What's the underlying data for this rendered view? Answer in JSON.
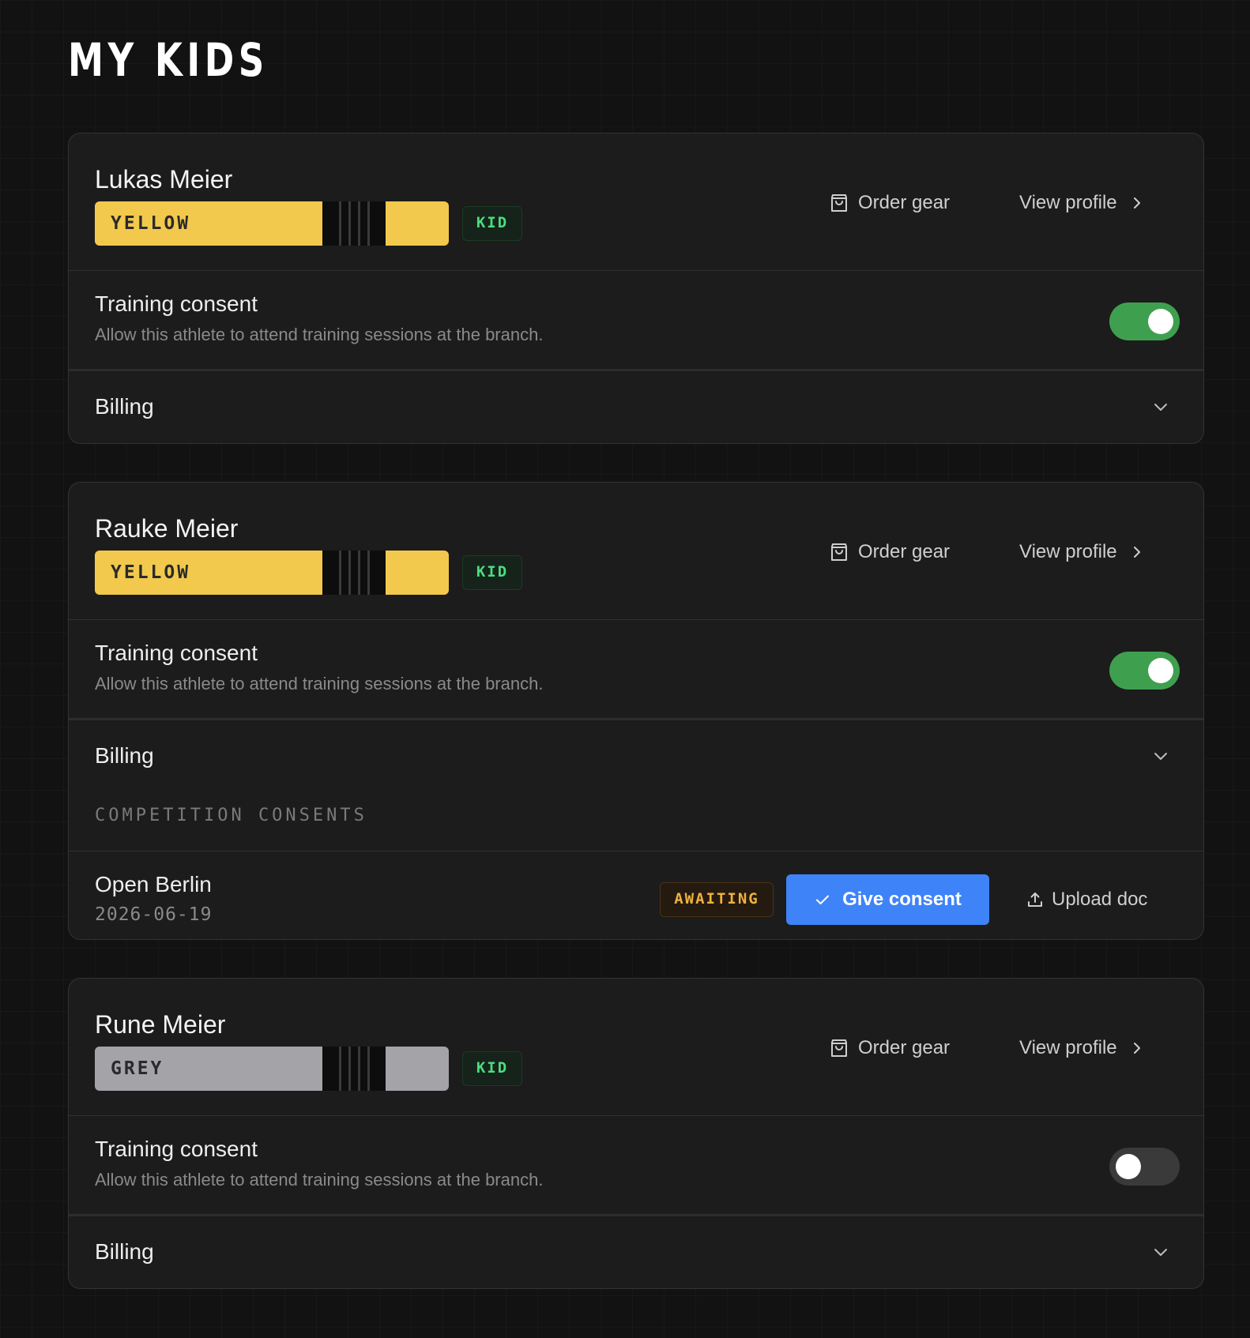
{
  "page": {
    "title": "MY KIDS"
  },
  "kids": [
    {
      "name": "Lukas Meier",
      "belt": {
        "label": "YELLOW",
        "color": "#f2c94c"
      },
      "badge": "KID",
      "order_gear": "Order gear",
      "view_profile": "View profile",
      "training_consent": {
        "title": "Training consent",
        "description": "Allow this athlete to attend training sessions at the branch.",
        "enabled": true
      },
      "billing_label": "Billing"
    },
    {
      "name": "Rauke Meier",
      "belt": {
        "label": "YELLOW",
        "color": "#f2c94c"
      },
      "badge": "KID",
      "order_gear": "Order gear",
      "view_profile": "View profile",
      "training_consent": {
        "title": "Training consent",
        "description": "Allow this athlete to attend training sessions at the branch.",
        "enabled": true
      },
      "billing_label": "Billing",
      "competition_consents": {
        "section_label": "COMPETITION CONSENTS",
        "items": [
          {
            "name": "Open Berlin",
            "date": "2026-06-19",
            "status": "AWAITING",
            "give_consent_label": "Give consent",
            "upload_doc_label": "Upload doc"
          }
        ]
      }
    },
    {
      "name": "Rune Meier",
      "belt": {
        "label": "GREY",
        "color": "#a3a3a8"
      },
      "badge": "KID",
      "order_gear": "Order gear",
      "view_profile": "View profile",
      "training_consent": {
        "title": "Training consent",
        "description": "Allow this athlete to attend training sessions at the branch.",
        "enabled": false
      },
      "billing_label": "Billing"
    }
  ],
  "colors": {
    "background": "#121212",
    "card": "#1c1c1c",
    "toggle_on": "#3ea04f",
    "toggle_off": "#3a3a3a",
    "kid_badge_text": "#4ade80",
    "awaiting_text": "#f0b23c",
    "primary_button": "#3f83f8"
  },
  "icons": {
    "order_gear": "shopping-bag-icon",
    "view_profile": "chevron-right-icon",
    "billing": "chevron-down-icon",
    "give_consent": "check-icon",
    "upload_doc": "upload-icon"
  }
}
